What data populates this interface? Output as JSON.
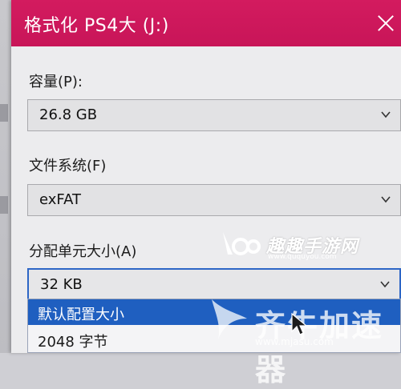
{
  "dialog": {
    "title": "格式化 PS4大 (J:)"
  },
  "capacity": {
    "label": "容量(P):",
    "value": "26.8 GB"
  },
  "filesystem": {
    "label": "文件系统(F)",
    "value": "exFAT"
  },
  "allocation": {
    "label": "分配单元大小(A)",
    "value": "32 KB",
    "options": [
      {
        "label": "默认配置大小",
        "selected": true
      },
      {
        "label": "2048 字节",
        "selected": false
      }
    ]
  },
  "watermarks": {
    "site_name": "趣趣手游网",
    "site_url": "www.ququyou.com",
    "brand_name": "齐牛加速器",
    "brand_url": "www.mjasu.com"
  },
  "colors": {
    "titlebar": "#d8175e",
    "selection": "#1f5fc0",
    "focus_border": "#2d66c6"
  },
  "icons": {
    "close": "close-icon",
    "dropdown": "chevron-down-icon",
    "pointer": "mouse-cursor-icon"
  }
}
